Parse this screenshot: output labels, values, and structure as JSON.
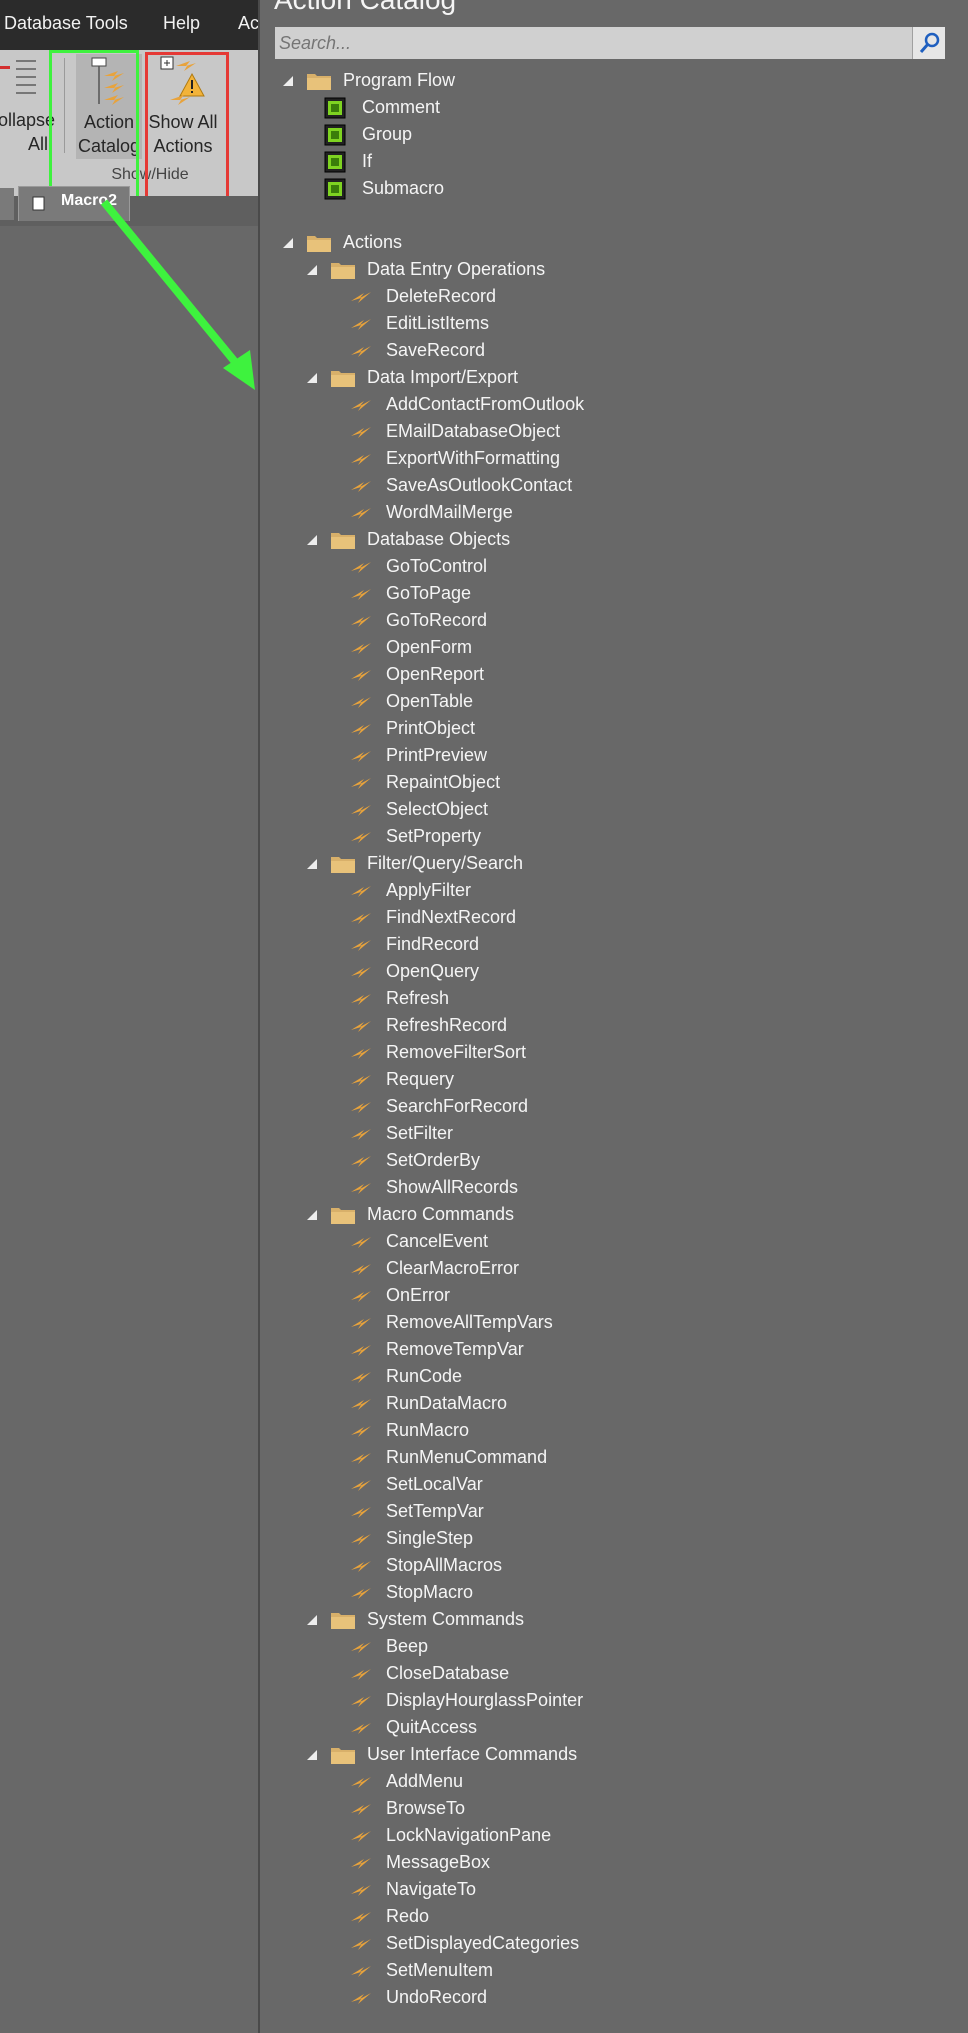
{
  "menubar": {
    "database_tools": "Database Tools",
    "help": "Help",
    "partial": "Ac"
  },
  "ribbon": {
    "collapse_label": "ollapse\nAll",
    "action_catalog_label": "Action\nCatalog",
    "show_all_actions_label": "Show All\nActions",
    "group_label": "Show/Hide"
  },
  "doc_tab": {
    "label": "Macro2"
  },
  "pane": {
    "title": "Action Catalog",
    "search_placeholder": "Search..."
  },
  "annotation_colors": {
    "arrow": "#3ef23e",
    "action_catalog_box": "#3ef23e",
    "show_all_box": "#e53935"
  },
  "tree": [
    {
      "level": 0,
      "type": "folder",
      "label": "Program Flow"
    },
    {
      "level": 1,
      "type": "flow",
      "label": "Comment"
    },
    {
      "level": 1,
      "type": "flow",
      "label": "Group"
    },
    {
      "level": 1,
      "type": "flow",
      "label": "If"
    },
    {
      "level": 1,
      "type": "flow",
      "label": "Submacro"
    },
    {
      "level": 0,
      "type": "spacer"
    },
    {
      "level": 0,
      "type": "folder",
      "label": "Actions"
    },
    {
      "level": 1,
      "type": "folder",
      "label": "Data Entry Operations"
    },
    {
      "level": 2,
      "type": "action",
      "label": "DeleteRecord"
    },
    {
      "level": 2,
      "type": "action",
      "label": "EditListItems"
    },
    {
      "level": 2,
      "type": "action",
      "label": "SaveRecord"
    },
    {
      "level": 1,
      "type": "folder",
      "label": "Data Import/Export"
    },
    {
      "level": 2,
      "type": "action",
      "label": "AddContactFromOutlook"
    },
    {
      "level": 2,
      "type": "action",
      "label": "EMailDatabaseObject"
    },
    {
      "level": 2,
      "type": "action",
      "label": "ExportWithFormatting"
    },
    {
      "level": 2,
      "type": "action",
      "label": "SaveAsOutlookContact"
    },
    {
      "level": 2,
      "type": "action",
      "label": "WordMailMerge"
    },
    {
      "level": 1,
      "type": "folder",
      "label": "Database Objects"
    },
    {
      "level": 2,
      "type": "action",
      "label": "GoToControl"
    },
    {
      "level": 2,
      "type": "action",
      "label": "GoToPage"
    },
    {
      "level": 2,
      "type": "action",
      "label": "GoToRecord"
    },
    {
      "level": 2,
      "type": "action",
      "label": "OpenForm"
    },
    {
      "level": 2,
      "type": "action",
      "label": "OpenReport"
    },
    {
      "level": 2,
      "type": "action",
      "label": "OpenTable"
    },
    {
      "level": 2,
      "type": "action",
      "label": "PrintObject"
    },
    {
      "level": 2,
      "type": "action",
      "label": "PrintPreview"
    },
    {
      "level": 2,
      "type": "action",
      "label": "RepaintObject"
    },
    {
      "level": 2,
      "type": "action",
      "label": "SelectObject"
    },
    {
      "level": 2,
      "type": "action",
      "label": "SetProperty"
    },
    {
      "level": 1,
      "type": "folder",
      "label": "Filter/Query/Search"
    },
    {
      "level": 2,
      "type": "action",
      "label": "ApplyFilter"
    },
    {
      "level": 2,
      "type": "action",
      "label": "FindNextRecord"
    },
    {
      "level": 2,
      "type": "action",
      "label": "FindRecord"
    },
    {
      "level": 2,
      "type": "action",
      "label": "OpenQuery"
    },
    {
      "level": 2,
      "type": "action",
      "label": "Refresh"
    },
    {
      "level": 2,
      "type": "action",
      "label": "RefreshRecord"
    },
    {
      "level": 2,
      "type": "action",
      "label": "RemoveFilterSort"
    },
    {
      "level": 2,
      "type": "action",
      "label": "Requery"
    },
    {
      "level": 2,
      "type": "action",
      "label": "SearchForRecord"
    },
    {
      "level": 2,
      "type": "action",
      "label": "SetFilter"
    },
    {
      "level": 2,
      "type": "action",
      "label": "SetOrderBy"
    },
    {
      "level": 2,
      "type": "action",
      "label": "ShowAllRecords"
    },
    {
      "level": 1,
      "type": "folder",
      "label": "Macro Commands"
    },
    {
      "level": 2,
      "type": "action",
      "label": "CancelEvent"
    },
    {
      "level": 2,
      "type": "action",
      "label": "ClearMacroError"
    },
    {
      "level": 2,
      "type": "action",
      "label": "OnError"
    },
    {
      "level": 2,
      "type": "action",
      "label": "RemoveAllTempVars"
    },
    {
      "level": 2,
      "type": "action",
      "label": "RemoveTempVar"
    },
    {
      "level": 2,
      "type": "action",
      "label": "RunCode"
    },
    {
      "level": 2,
      "type": "action",
      "label": "RunDataMacro"
    },
    {
      "level": 2,
      "type": "action",
      "label": "RunMacro"
    },
    {
      "level": 2,
      "type": "action",
      "label": "RunMenuCommand"
    },
    {
      "level": 2,
      "type": "action",
      "label": "SetLocalVar"
    },
    {
      "level": 2,
      "type": "action",
      "label": "SetTempVar"
    },
    {
      "level": 2,
      "type": "action",
      "label": "SingleStep"
    },
    {
      "level": 2,
      "type": "action",
      "label": "StopAllMacros"
    },
    {
      "level": 2,
      "type": "action",
      "label": "StopMacro"
    },
    {
      "level": 1,
      "type": "folder",
      "label": "System Commands"
    },
    {
      "level": 2,
      "type": "action",
      "label": "Beep"
    },
    {
      "level": 2,
      "type": "action",
      "label": "CloseDatabase"
    },
    {
      "level": 2,
      "type": "action",
      "label": "DisplayHourglassPointer"
    },
    {
      "level": 2,
      "type": "action",
      "label": "QuitAccess"
    },
    {
      "level": 1,
      "type": "folder",
      "label": "User Interface Commands"
    },
    {
      "level": 2,
      "type": "action",
      "label": "AddMenu"
    },
    {
      "level": 2,
      "type": "action",
      "label": "BrowseTo"
    },
    {
      "level": 2,
      "type": "action",
      "label": "LockNavigationPane"
    },
    {
      "level": 2,
      "type": "action",
      "label": "MessageBox"
    },
    {
      "level": 2,
      "type": "action",
      "label": "NavigateTo"
    },
    {
      "level": 2,
      "type": "action",
      "label": "Redo"
    },
    {
      "level": 2,
      "type": "action",
      "label": "SetDisplayedCategories"
    },
    {
      "level": 2,
      "type": "action",
      "label": "SetMenuItem"
    },
    {
      "level": 2,
      "type": "action",
      "label": "UndoRecord"
    }
  ]
}
